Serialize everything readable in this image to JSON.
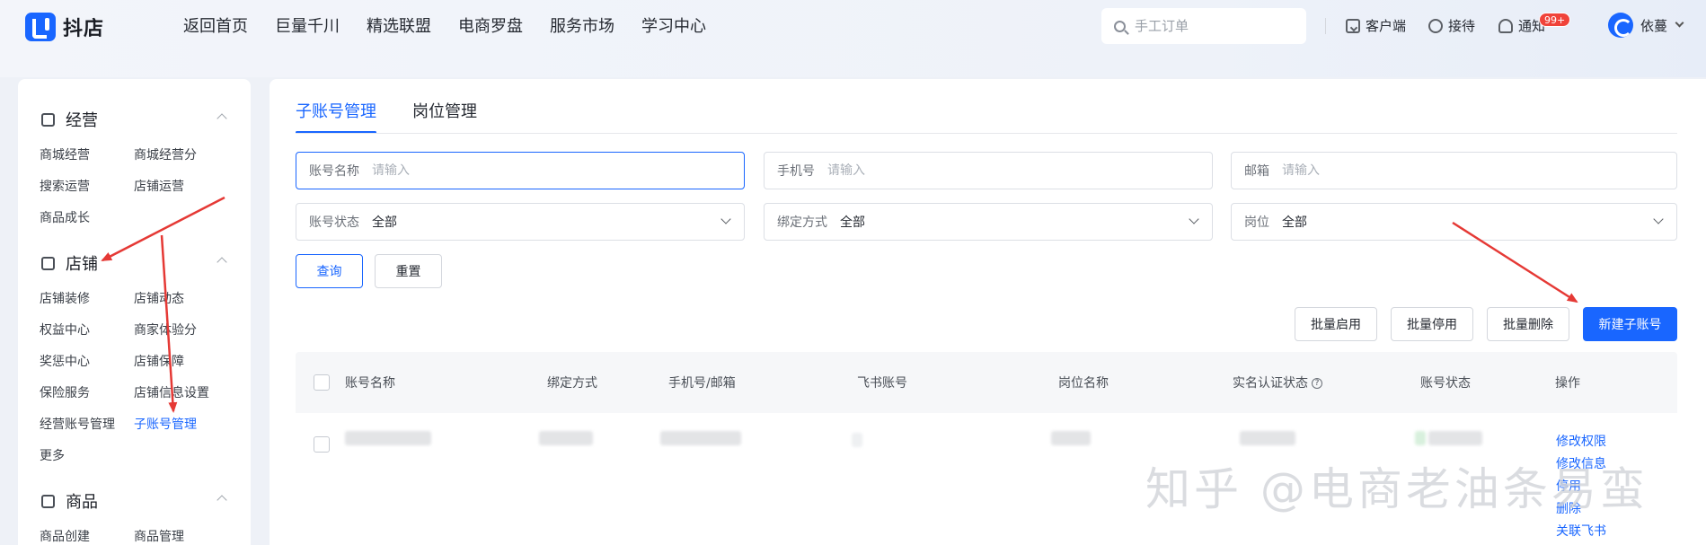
{
  "app": {
    "logo_text": "抖店",
    "brand_color": "#1966ff"
  },
  "topnav": {
    "items": [
      "返回首页",
      "巨量千川",
      "精选联盟",
      "电商罗盘",
      "服务市场",
      "学习中心"
    ]
  },
  "search": {
    "placeholder": "手工订单",
    "icon": "search-icon"
  },
  "tools": {
    "client": "客户端",
    "reception": "接待",
    "notify": "通知",
    "notify_badge": "99+",
    "username": "依蔓"
  },
  "sidebar": {
    "groups": [
      {
        "title": "经营",
        "icon": "chart-icon",
        "items": [
          "商城经营",
          "商城经营分",
          "搜索运营",
          "店铺运营",
          "商品成长"
        ]
      },
      {
        "title": "店铺",
        "icon": "shop-icon",
        "items": [
          "店铺装修",
          "店铺动态",
          "权益中心",
          "商家体验分",
          "奖惩中心",
          "店铺保障",
          "保险服务",
          "店铺信息设置",
          "经营账号管理",
          "子账号管理",
          "更多"
        ]
      },
      {
        "title": "商品",
        "icon": "goods-icon",
        "items": [
          "商品创建",
          "商品管理"
        ]
      }
    ]
  },
  "tabs": [
    "子账号管理",
    "岗位管理"
  ],
  "filters": {
    "account_name": {
      "label": "账号名称",
      "placeholder": "请输入"
    },
    "phone": {
      "label": "手机号",
      "placeholder": "请输入"
    },
    "email": {
      "label": "邮箱",
      "placeholder": "请输入"
    },
    "account_status": {
      "label": "账号状态",
      "value": "全部"
    },
    "bind_method": {
      "label": "绑定方式",
      "value": "全部"
    },
    "position": {
      "label": "岗位",
      "value": "全部"
    }
  },
  "actions": {
    "query": "查询",
    "reset": "重置",
    "batch_enable": "批量启用",
    "batch_disable": "批量停用",
    "batch_delete": "批量删除",
    "new_sub_account": "新建子账号"
  },
  "table": {
    "headers": [
      "账号名称",
      "绑定方式",
      "手机号/邮箱",
      "飞书账号",
      "岗位名称",
      "实名认证状态",
      "账号状态",
      "操作"
    ],
    "row_operations": [
      "修改权限",
      "修改信息",
      "停用",
      "删除",
      "关联飞书"
    ]
  },
  "watermark": "知乎 @电商老油条易蛮",
  "annotation_color": "#e53935"
}
